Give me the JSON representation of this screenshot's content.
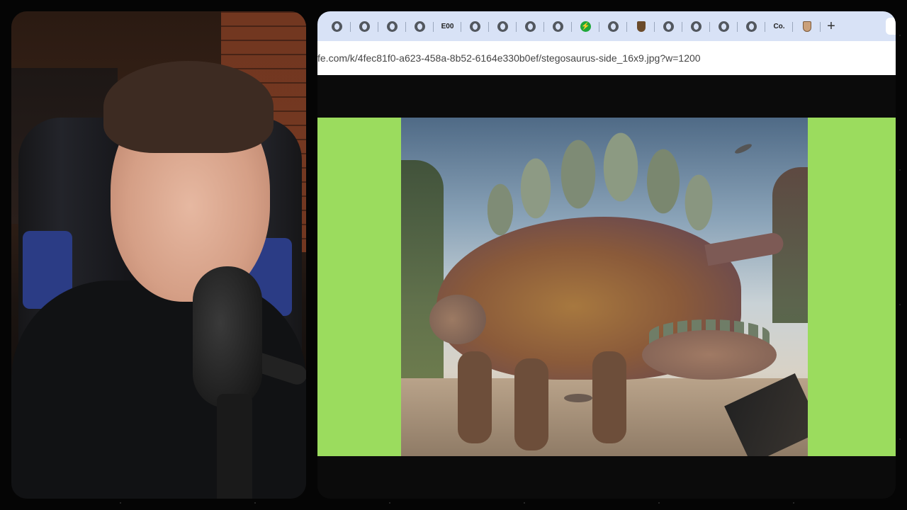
{
  "browser": {
    "tabs": [
      {
        "icon": "globe-icon"
      },
      {
        "icon": "globe-icon"
      },
      {
        "icon": "globe-icon"
      },
      {
        "icon": "globe-icon"
      },
      {
        "icon": "text-favicon",
        "label": "E00"
      },
      {
        "icon": "globe-icon"
      },
      {
        "icon": "globe-icon"
      },
      {
        "icon": "globe-icon"
      },
      {
        "icon": "globe-icon"
      },
      {
        "icon": "bolt-icon",
        "color": "#1fa83a"
      },
      {
        "icon": "globe-icon"
      },
      {
        "icon": "shield-icon"
      },
      {
        "icon": "globe-icon"
      },
      {
        "icon": "globe-icon"
      },
      {
        "icon": "globe-icon"
      },
      {
        "icon": "globe-icon"
      },
      {
        "icon": "text-favicon",
        "label": "Co."
      },
      {
        "icon": "shield-icon"
      }
    ],
    "new_tab_label": "+",
    "url": "fe.com/k/4fec81f0-a623-458a-8b52-6164e330b0ef/stegosaurus-side_16x9.jpg?w=1200"
  },
  "colors": {
    "tabbar_bg": "#d8e2f6",
    "letterbox_green": "#9bdc5e",
    "page_bg": "#0b0b0b"
  },
  "webcam": {
    "content": "streamer-webcam"
  },
  "image": {
    "content": "stegosaurus-illustration"
  }
}
